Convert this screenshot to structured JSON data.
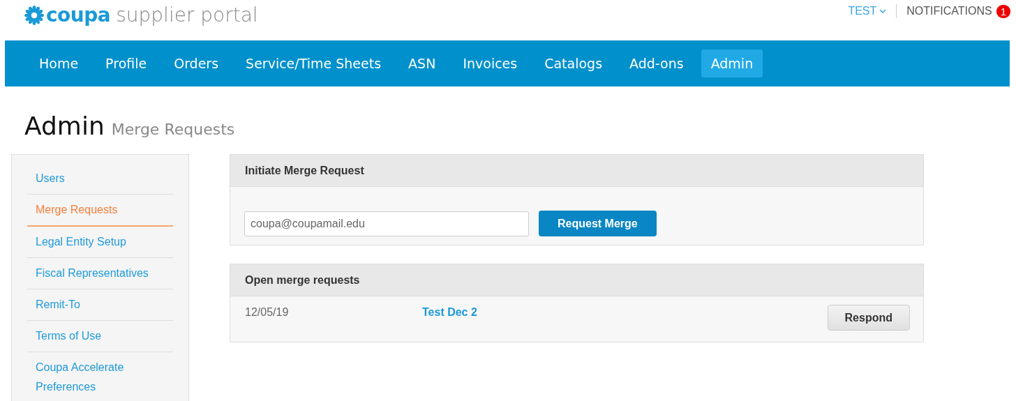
{
  "header": {
    "brand": "coupa",
    "product": "supplier portal",
    "user_menu": "TEST",
    "notifications": {
      "label": "NOTIFICATIONS",
      "count": "1"
    }
  },
  "nav": [
    {
      "label": "Home",
      "selected": false
    },
    {
      "label": "Profile",
      "selected": false
    },
    {
      "label": "Orders",
      "selected": false
    },
    {
      "label": "Service/Time Sheets",
      "selected": false
    },
    {
      "label": "ASN",
      "selected": false
    },
    {
      "label": "Invoices",
      "selected": false
    },
    {
      "label": "Catalogs",
      "selected": false
    },
    {
      "label": "Add-ons",
      "selected": false
    },
    {
      "label": "Admin",
      "selected": true
    }
  ],
  "page_title": {
    "title": "Admin",
    "subtitle": "Merge Requests"
  },
  "sidebar": {
    "items": [
      {
        "label": "Users",
        "selected": false
      },
      {
        "label": "Merge Requests",
        "selected": true
      },
      {
        "label": "Legal Entity Setup",
        "selected": false
      },
      {
        "label": "Fiscal Representatives",
        "selected": false
      },
      {
        "label": "Remit-To",
        "selected": false
      },
      {
        "label": "Terms of Use",
        "selected": false
      },
      {
        "label": "Coupa Accelerate Preferences",
        "selected": false
      }
    ]
  },
  "initiate_panel": {
    "title": "Initiate Merge Request",
    "email": {
      "value": "coupa@coupamail.edu"
    },
    "button": "Request Merge"
  },
  "open_panel": {
    "title": "Open merge requests",
    "rows": [
      {
        "date": "12/05/19",
        "name": "Test Dec 2",
        "action": "Respond"
      }
    ]
  }
}
